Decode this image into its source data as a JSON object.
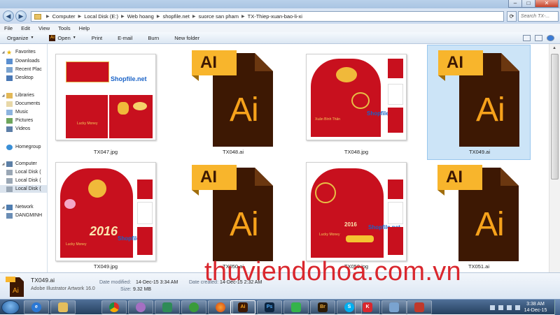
{
  "window": {
    "controls": [
      "–",
      "□",
      "✕"
    ]
  },
  "address": {
    "segments": [
      "Computer",
      "Local Disk (E:)",
      "Web hoang",
      "shopfile.net",
      "suorce san pham",
      "TX-Thiep-xuan-bao-li-xi"
    ],
    "search_placeholder": "Search TX-..."
  },
  "menu": [
    "File",
    "Edit",
    "View",
    "Tools",
    "Help"
  ],
  "commands": {
    "organize": "Organize",
    "open": "Open",
    "print": "Print",
    "email": "E-mail",
    "burn": "Burn",
    "new_folder": "New folder"
  },
  "sidebar": {
    "favorites": "Favorites",
    "downloads": "Downloads",
    "recent": "Recent Plac",
    "desktop": "Desktop",
    "libraries": "Libraries",
    "documents": "Documents",
    "music": "Music",
    "pictures": "Pictures",
    "videos": "Videos",
    "homegroup": "Homegroup",
    "computer": "Computer",
    "disk1": "Local Disk (",
    "disk2": "Local Disk (",
    "disk3": "Local Disk (",
    "network": "Network",
    "host": "DANGMINH"
  },
  "files": [
    {
      "name": "TX047.jpg",
      "kind": "jpg",
      "watermark": "Shopfile.net",
      "card_text": "Lucky Money"
    },
    {
      "name": "TX048.ai",
      "kind": "ai",
      "badge": "AI",
      "logo": "Ai"
    },
    {
      "name": "TX048.jpg",
      "kind": "jpg",
      "watermark": "Shopfile.net",
      "card_text": "Xuân Bính Thân"
    },
    {
      "name": "TX049.ai",
      "kind": "ai",
      "badge": "AI",
      "logo": "Ai",
      "selected": true
    },
    {
      "name": "TX049.jpg",
      "kind": "jpg",
      "watermark": "Shopfile.net",
      "card_text": "Lucky Money"
    },
    {
      "name": "TX050.ai",
      "kind": "ai",
      "badge": "AI",
      "logo": "Ai"
    },
    {
      "name": "TX050.jpg",
      "kind": "jpg",
      "watermark": "Shopfile.net",
      "card_text": "Lucky Money"
    },
    {
      "name": "TX051.ai",
      "kind": "ai",
      "badge": "AI",
      "logo": "Ai"
    }
  ],
  "details": {
    "name": "TX049.ai",
    "type": "Adobe Illustrator Artwork 16.0",
    "modified_label": "Date modified:",
    "modified": "14-Dec-15 3:34 AM",
    "created_label": "Date created:",
    "created": "14-Dec-15 2:32 AM",
    "size_label": "Size:",
    "size": "9.32 MB"
  },
  "watermark": "thuviendohoa.com.vn",
  "taskbar": {
    "apps": [
      "IE",
      "Explorer",
      "Chrome",
      "Pidgin",
      "App",
      "CCleaner",
      "Firefox",
      "Ai",
      "Ps",
      "Dw",
      "Br",
      "Skype",
      "Kingsoft",
      "Monitor",
      "Game"
    ],
    "time": "3:38 AM",
    "date": "14-Dec-15"
  },
  "colors": {
    "ai_dark": "#3d1803",
    "ai_orange": "#f7a21b",
    "ai_label": "#f8b52c",
    "watermark": "#d9272e",
    "envelope": "#c8101e"
  }
}
